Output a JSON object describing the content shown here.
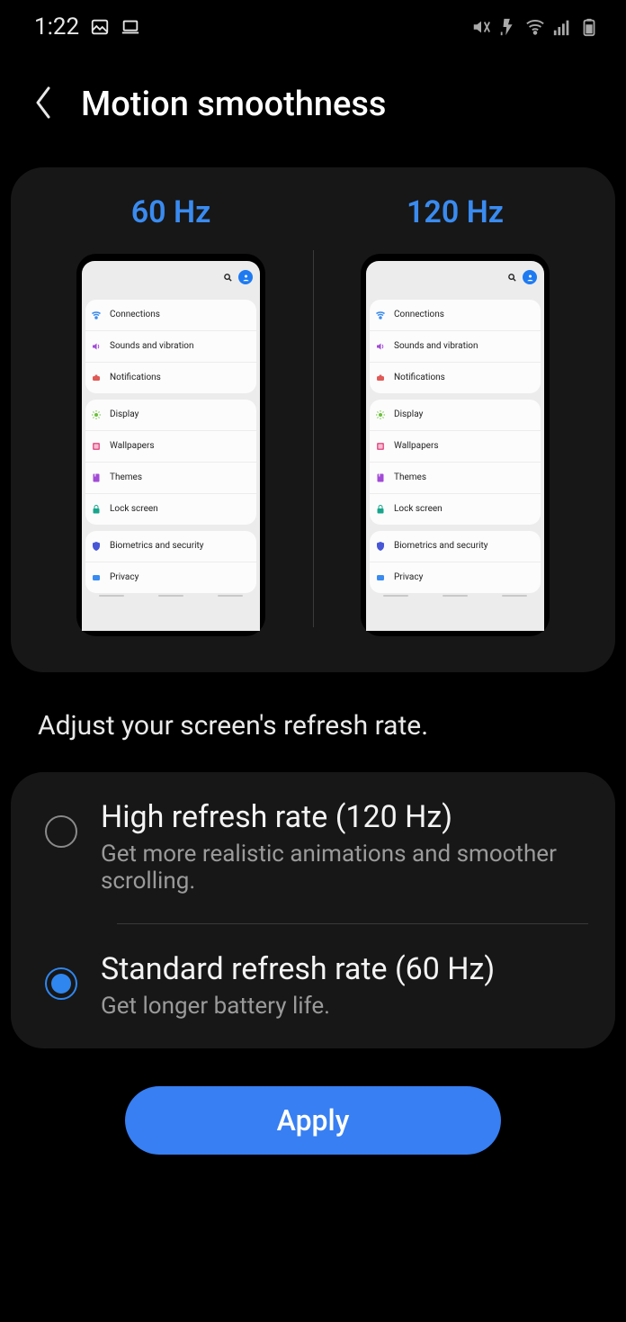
{
  "status": {
    "time": "1:22",
    "icons": {
      "gallery": "gallery-icon",
      "laptop": "laptop-icon",
      "mute": "mute-vibrate-icon",
      "flash_off": "flash-off-icon",
      "wifi": "wifi-icon",
      "signal": "signal-icon",
      "battery": "battery-icon"
    }
  },
  "header": {
    "title": "Motion smoothness"
  },
  "preview": {
    "left_label": "60 Hz",
    "right_label": "120 Hz",
    "settings_items": [
      {
        "group": 0,
        "label": "Connections",
        "icon": "wifi",
        "color": "#3a8bf0"
      },
      {
        "group": 0,
        "label": "Sounds and vibration",
        "icon": "sound",
        "color": "#a24bd6"
      },
      {
        "group": 0,
        "label": "Notifications",
        "icon": "notif",
        "color": "#e05a57"
      },
      {
        "group": 1,
        "label": "Display",
        "icon": "display",
        "color": "#6bbf3a"
      },
      {
        "group": 1,
        "label": "Wallpapers",
        "icon": "wall",
        "color": "#e65a8d"
      },
      {
        "group": 1,
        "label": "Themes",
        "icon": "themes",
        "color": "#a24bd6"
      },
      {
        "group": 1,
        "label": "Lock screen",
        "icon": "lock",
        "color": "#17a58c"
      },
      {
        "group": 2,
        "label": "Biometrics and security",
        "icon": "shield",
        "color": "#4757d6"
      },
      {
        "group": 2,
        "label": "Privacy",
        "icon": "privacy",
        "color": "#3a8bf0"
      }
    ]
  },
  "description": "Adjust your screen's refresh rate.",
  "options": [
    {
      "id": "high",
      "title": "High refresh rate (120 Hz)",
      "subtitle": "Get more realistic animations and smoother scrolling.",
      "selected": false
    },
    {
      "id": "standard",
      "title": "Standard refresh rate (60 Hz)",
      "subtitle": "Get longer battery life.",
      "selected": true
    }
  ],
  "apply_label": "Apply",
  "colors": {
    "accent": "#377ff2",
    "link_blue": "#3a8bf0",
    "card_bg": "#171717"
  }
}
